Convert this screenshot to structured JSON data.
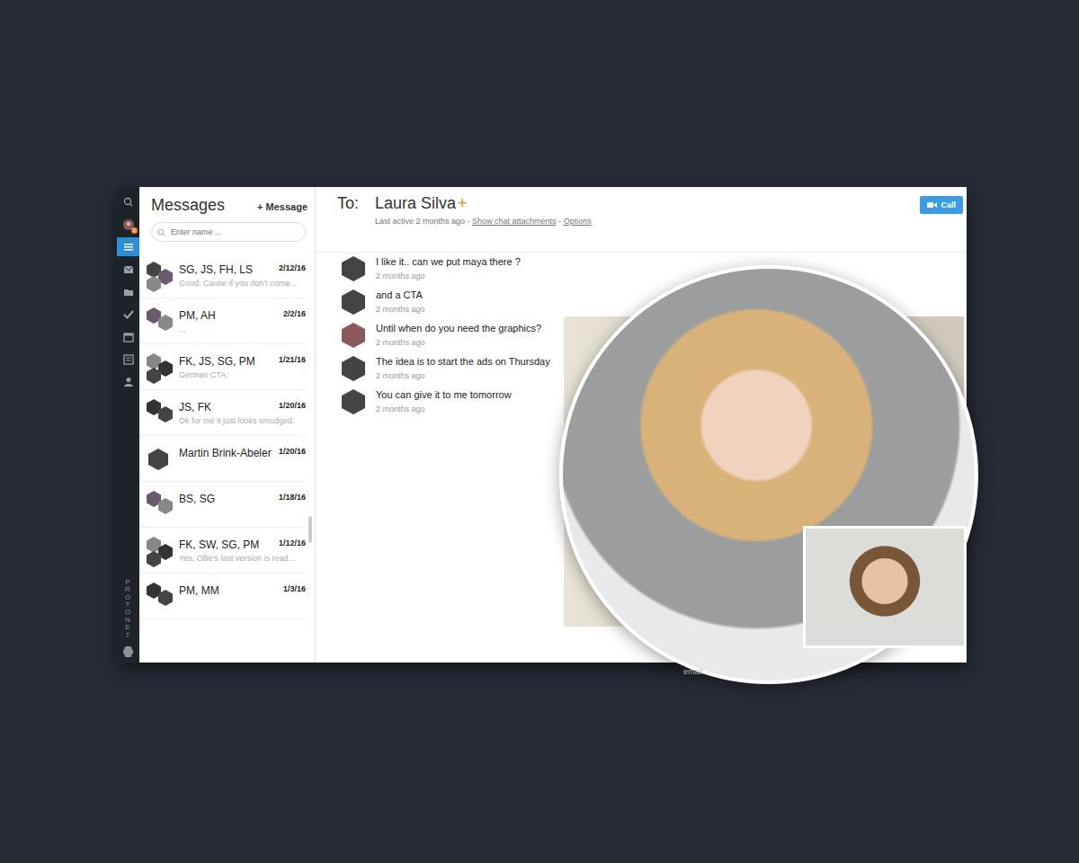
{
  "app": {
    "brand": "PROTONET",
    "badge": "1"
  },
  "nav": [
    {
      "item": "search",
      "selected": false
    },
    {
      "item": "profile",
      "selected": false
    },
    {
      "item": "messages",
      "selected": true
    },
    {
      "item": "mail",
      "selected": false
    },
    {
      "item": "files",
      "selected": false
    },
    {
      "item": "tasks",
      "selected": false
    },
    {
      "item": "calendar",
      "selected": false
    },
    {
      "item": "contacts",
      "selected": false
    },
    {
      "item": "people",
      "selected": false
    }
  ],
  "list": {
    "title": "Messages",
    "new_button": "+ Message",
    "search_placeholder": "Enter name ...",
    "rows": [
      {
        "name": "SG, JS, FH, LS",
        "date": "2/12/16",
        "preview": "Good. Cause if you don't come..."
      },
      {
        "name": "PM, AH",
        "date": "2/2/16",
        "preview": "..."
      },
      {
        "name": "FK, JS, SG, PM",
        "date": "1/21/16",
        "preview": "German CTA:"
      },
      {
        "name": "JS, FK",
        "date": "1/20/16",
        "preview": "Ok for me it just looks smudged."
      },
      {
        "name": "Martin Brink-Abeler",
        "date": "1/20/16",
        "preview": ""
      },
      {
        "name": "BS, SG",
        "date": "1/18/16",
        "preview": ""
      },
      {
        "name": "FK, SW, SG, PM",
        "date": "1/12/16",
        "preview": "Yes, Ollie's last version is read..."
      },
      {
        "name": "PM, MM",
        "date": "1/3/16",
        "preview": ""
      }
    ]
  },
  "chat": {
    "to_label": "To:",
    "recipient": "Laura Silva",
    "add": "+",
    "last_active": "Last active 2 months ago",
    "sep": " - ",
    "attachments_link": "Show chat attachments",
    "options_link": "Options",
    "call_button": "Call",
    "messages": [
      {
        "text": "I like it.. can we put maya there ?",
        "time": "2 months ago"
      },
      {
        "text": "and a CTA",
        "time": "2 months ago"
      },
      {
        "text": "Until when do you need the graphics?",
        "time": "2 months ago"
      },
      {
        "text": "The idea is to start the ads on Thursday",
        "time": "2 months ago"
      },
      {
        "text": "You can give it to me tomorrow",
        "time": "2 months ago"
      }
    ],
    "composer_hint": "email."
  }
}
